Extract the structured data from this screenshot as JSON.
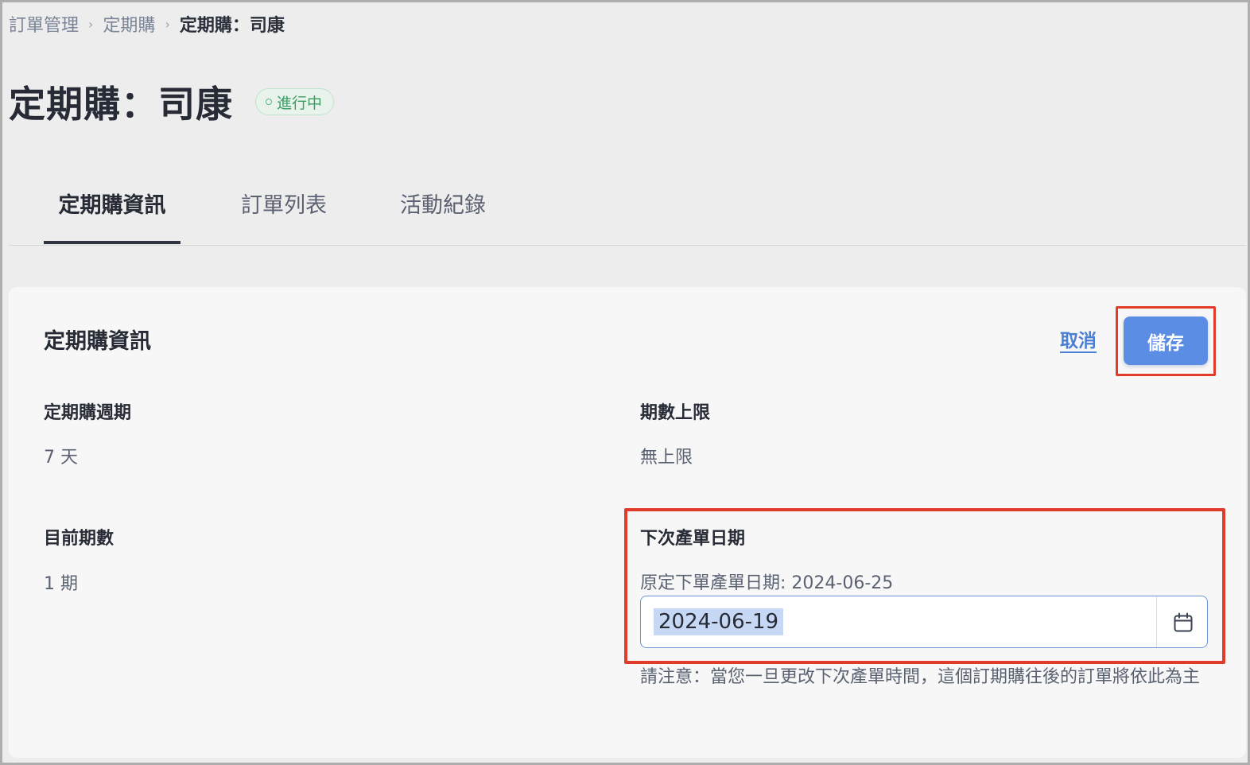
{
  "breadcrumb": {
    "items": [
      "訂單管理",
      "定期購",
      "定期購：司康"
    ]
  },
  "header": {
    "title": "定期購：司康",
    "status": "進行中"
  },
  "tabs": [
    {
      "label": "定期購資訊",
      "active": true
    },
    {
      "label": "訂單列表",
      "active": false
    },
    {
      "label": "活動紀錄",
      "active": false
    }
  ],
  "card": {
    "title": "定期購資訊",
    "cancel_label": "取消",
    "save_label": "儲存",
    "fields": {
      "cycle": {
        "label": "定期購週期",
        "value": "7 天"
      },
      "limit": {
        "label": "期數上限",
        "value": "無上限"
      },
      "current": {
        "label": "目前期數",
        "value": "1 期"
      },
      "next_date": {
        "label": "下次產單日期",
        "original": "原定下單產單日期: 2024-06-25",
        "value": "2024-06-19",
        "note": "請注意：當您一旦更改下次產單時間，這個訂期購往後的訂單將依此為主"
      }
    }
  },
  "colors": {
    "accent": "#5b8de5",
    "highlight": "#e13b2c",
    "status_green": "#3c9d63"
  }
}
